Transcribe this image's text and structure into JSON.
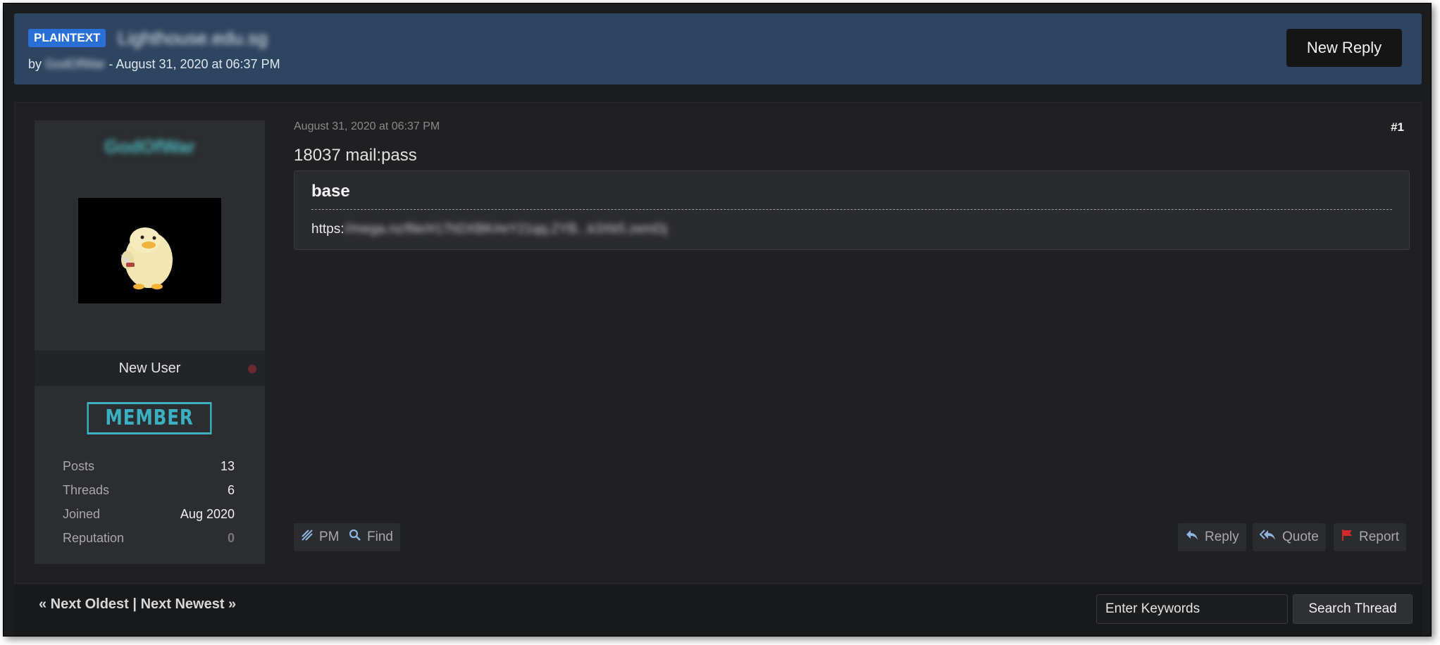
{
  "header": {
    "prefix": "PLAINTEXT",
    "title": "Lighthouse.edu.sg",
    "by_label": "by",
    "author": "GodOfWar",
    "date_text": "- August 31, 2020 at 06:37 PM",
    "new_reply_label": "New Reply"
  },
  "author_panel": {
    "username": "GodOfWar",
    "user_title": "New User",
    "group_badge": "MEMBER",
    "stats": [
      {
        "label": "Posts",
        "value": "13"
      },
      {
        "label": "Threads",
        "value": "6"
      },
      {
        "label": "Joined",
        "value": "Aug 2020"
      },
      {
        "label": "Reputation",
        "value": "0"
      }
    ]
  },
  "post": {
    "date": "August 31, 2020 at 06:37 PM",
    "number": "#1",
    "subject": "18037 mail:pass",
    "code_title": "base",
    "link_prefix": "https:",
    "link_rest": "//mega.nz/file/#17hDXBK#eY21qq.ZYB...k3Xk5.zemDj",
    "left_buttons": [
      {
        "icon": "pm-icon",
        "label": "PM"
      },
      {
        "icon": "search-icon",
        "label": "Find"
      }
    ],
    "right_buttons": [
      {
        "icon": "reply-icon",
        "label": "Reply"
      },
      {
        "icon": "quote-icon",
        "label": "Quote"
      },
      {
        "icon": "flag-icon",
        "label": "Report"
      }
    ]
  },
  "footer": {
    "prev_label": "« Next Oldest",
    "separator": "|",
    "next_label": "Next Newest »",
    "search_value": "Enter Keywords",
    "search_button": "Search Thread"
  },
  "colors": {
    "header_bg": "#2d4560",
    "prefix_badge": "#2a6fd6",
    "member_badge": "#3bb0c0",
    "report_flag": "#d12a2a"
  }
}
